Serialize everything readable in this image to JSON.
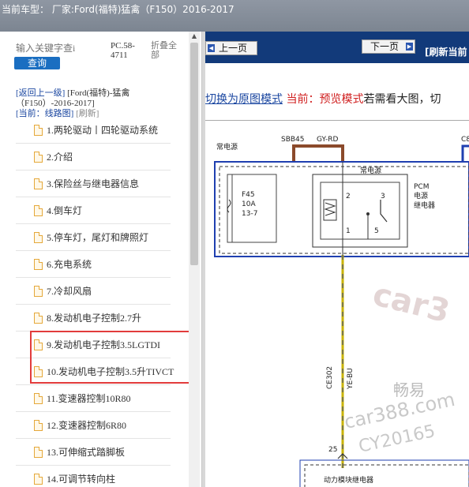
{
  "header": {
    "title": "当前车型： 厂家:Ford(福特)猛禽（F150）2016-2017"
  },
  "sidebar": {
    "search_placeholder": "输入关键字查i",
    "search_button": "查询",
    "code": "PC.58-4711",
    "collapse_all": "折叠全部",
    "breadcrumb": {
      "back": "[返回上一级]",
      "model": "[Ford(福特)-猛禽（F150）-2016-2017]",
      "current": "[当前：线路图]",
      "refresh": "[刷新]"
    },
    "items": [
      {
        "label": "1.两轮驱动丨四轮驱动系统"
      },
      {
        "label": "2.介绍"
      },
      {
        "label": "3.保险丝与继电器信息"
      },
      {
        "label": "4.倒车灯"
      },
      {
        "label": "5.停车灯，尾灯和牌照灯"
      },
      {
        "label": "6.充电系统"
      },
      {
        "label": "7.冷却风扇"
      },
      {
        "label": "8.发动机电子控制2.7升"
      },
      {
        "label": "9.发动机电子控制3.5LGTDI"
      },
      {
        "label": "10.发动机电子控制3.5升TIVCT"
      },
      {
        "label": "11.变速器控制10R80"
      },
      {
        "label": "12.变速器控制6R80"
      },
      {
        "label": "13.可伸缩式踏脚板"
      },
      {
        "label": "14.可调节转向柱"
      }
    ]
  },
  "toolbar": {
    "prev": "上一页",
    "next": "下一页",
    "refresh": "[刷新当前"
  },
  "mode": {
    "switch_link": "切换为原图模式",
    "current": "当前：预览模式",
    "hint": "若需看大图，切"
  },
  "diagram": {
    "label_power": "常电源",
    "label_sbb45": "SBB45",
    "label_gyrd": "GY-RD",
    "label_c8": "C8",
    "label_power2": "常电源",
    "fuse_f45": "F45",
    "fuse_10a": "10A",
    "fuse_137": "13-7",
    "relay_pcm": "PCM",
    "relay_power": "电源",
    "relay_relay": "继电器",
    "pin_2": "2",
    "pin_3": "3",
    "pin_1": "1",
    "pin_5": "5",
    "wire_ce302": "CE302",
    "wire_yebu": "YE-BU",
    "pin_25": "25",
    "module_label": "动力模块继电器",
    "watermark_car": "car3",
    "watermark_cy": "畅易",
    "watermark_site": "car388.com",
    "watermark_id": "CY20165"
  }
}
